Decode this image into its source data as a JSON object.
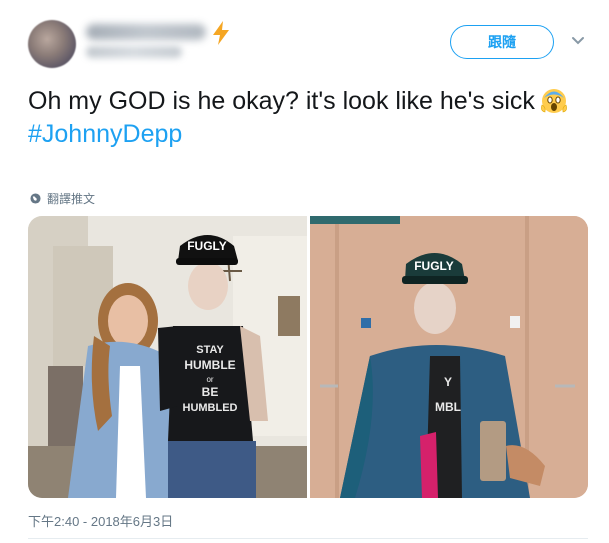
{
  "header": {
    "follow_label": "跟隨",
    "verified_icon": "lightning-bolt-icon",
    "more_icon": "chevron-down-icon"
  },
  "tweet": {
    "text_line": "Oh my GOD is he okay? it's look like he's sick",
    "emoji": "face-screaming-in-fear",
    "hashtag": "#JohnnyDepp",
    "translate_label": "翻譯推文",
    "timestamp": "下午2:40 - 2018年6月3日"
  },
  "media": {
    "left_photo": {
      "cap_text": "FUGLY",
      "shirt_lines": [
        "STAY",
        "HUMBLE",
        "or",
        "BE",
        "HUMBLED"
      ]
    },
    "right_photo": {
      "cap_text": "FUGLY",
      "shirt_lines": [
        "Y",
        "MBL"
      ]
    }
  },
  "colors": {
    "accent": "#1da1f2",
    "text": "#14171a",
    "muted": "#657786",
    "bolt": "#f5a623"
  }
}
